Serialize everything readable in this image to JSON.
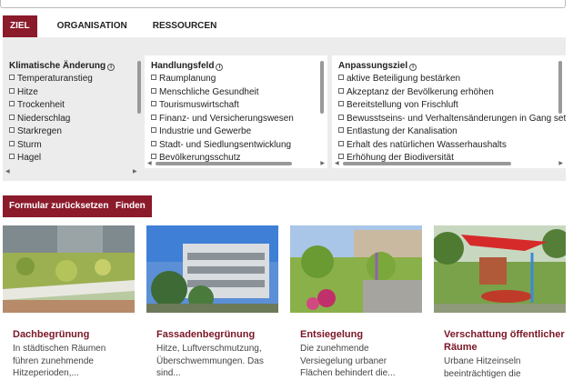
{
  "tabs": [
    "ZIEL",
    "ORGANISATION",
    "RESSOURCEN"
  ],
  "info_icon": "info-icon",
  "columns": {
    "klima": {
      "title": "Klimatische Änderung",
      "items": [
        "Temperaturanstieg",
        "Hitze",
        "Trockenheit",
        "Niederschlag",
        "Starkregen",
        "Sturm",
        "Hagel"
      ]
    },
    "handlung": {
      "title": "Handlungsfeld",
      "items": [
        "Raumplanung",
        "Menschliche Gesundheit",
        "Tourismuswirtschaft",
        "Finanz- und Versicherungswesen",
        "Industrie und Gewerbe",
        "Stadt- und Siedlungsentwicklung",
        "Bevölkerungsschutz"
      ]
    },
    "ziel": {
      "title": "Anpassungsziel",
      "items": [
        "aktive Beteiligung bestärken",
        "Akzeptanz der Bevölkerung erhöhen",
        "Bereitstellung von Frischluft",
        "Bewusstseins- und Verhaltensänderungen in Gang setzen",
        "Entlastung der Kanalisation",
        "Erhalt des natürlichen Wasserhaushalts",
        "Erhöhung der Biodiversität"
      ]
    }
  },
  "buttons": {
    "reset": "Formular zurücksetzen",
    "find": "Finden"
  },
  "cards": [
    {
      "title": "Dachbegrünung",
      "text": "In städtischen Räumen führen zunehmende Hitzeperioden,..."
    },
    {
      "title": "Fassadenbegrünung",
      "text": "Hitze, Luftverschmutzung, Überschwemmungen. Das sind..."
    },
    {
      "title": "Entsiegelung",
      "text": "Die zunehmende Versiegelung urbaner Flächen behindert die..."
    },
    {
      "title": "Verschattung öffentlicher Räume",
      "text": "Urbane Hitzeinseln beeinträchtigen die"
    }
  ],
  "colors": {
    "accent": "#8b1a2b",
    "card_title": "#7a1526",
    "panel": "#ececec"
  }
}
